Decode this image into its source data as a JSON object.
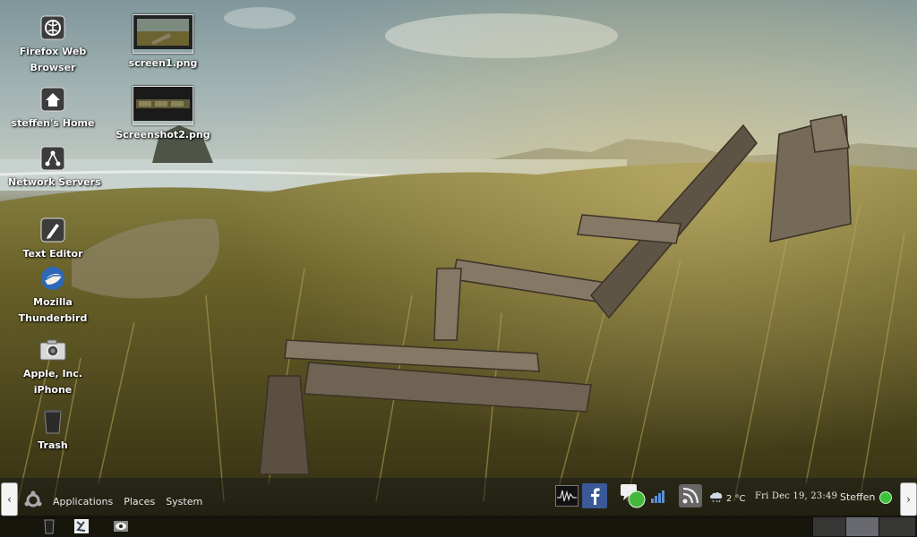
{
  "desktop": {
    "icons": [
      {
        "name": "Firefox Web",
        "name2": "Browser",
        "icon": "globe-icon"
      },
      {
        "name": "steffen's Home",
        "icon": "home-icon"
      },
      {
        "name": "Network Servers",
        "icon": "network-icon"
      },
      {
        "name": "Text Editor",
        "icon": "text-editor-icon"
      },
      {
        "name": "Mozilla",
        "name2": "Thunderbird",
        "icon": "thunderbird-icon"
      },
      {
        "name": "Apple, Inc.",
        "name2": "iPhone",
        "icon": "camera-icon"
      },
      {
        "name": "Trash",
        "icon": "trash-icon"
      }
    ],
    "files": [
      {
        "name": "screen1.png"
      },
      {
        "name": "Screenshot2.png"
      }
    ]
  },
  "panel": {
    "menus": [
      "Applications",
      "Places",
      "System"
    ],
    "weather": "2 °C",
    "clock": "Fri Dec 19, 23:49",
    "user": "Steffen",
    "status_color": "#3bc43b",
    "left_arrow": "‹",
    "right_arrow": "›"
  }
}
